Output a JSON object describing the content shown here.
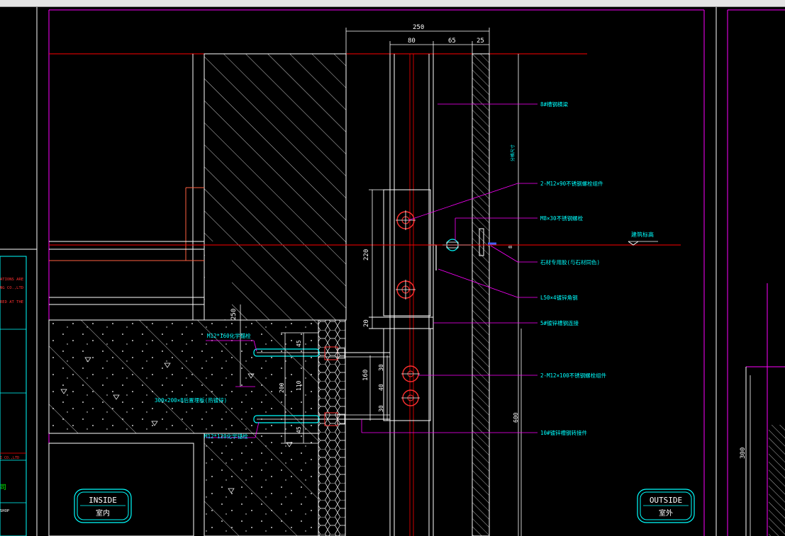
{
  "colors": {
    "background": "#000000",
    "frame": "#ff00ff",
    "dim": "#ffffff",
    "text": "#00ffff",
    "structure": "#ffffff",
    "level_line": "#ff0000",
    "bolt": "#ff3030",
    "hatch": "#ffffff"
  },
  "dimensions": {
    "top_total": "250",
    "top_a": "80",
    "top_b": "65",
    "top_c": "25",
    "v_220": "220",
    "v_20": "20",
    "v_250": "250",
    "v_160": "160",
    "v_30a": "30",
    "v_40": "40",
    "v_30b": "30",
    "v_45a": "45",
    "v_200": "200",
    "v_110": "110",
    "v_45b": "45",
    "v_600": "600",
    "v_8": "8",
    "v_300": "300",
    "v_split": "分格尺寸"
  },
  "labels": {
    "l1": "8#槽钢横梁",
    "l2": "2-M12×90不锈钢螺栓组件",
    "l3": "M8×30不锈钢螺栓",
    "l4": "建筑标高",
    "l5": "石材专用胶(与石材同色)",
    "l6": "L50×4镀锌角钢",
    "l7": "5#镀锌槽钢连接",
    "l8": "2-M12×100不锈钢螺栓组件",
    "l9": "10#镀锌槽钢转接件",
    "l10": "M12*160化学锚栓",
    "l11": "300×200×8后置埋板(热镀锌)",
    "l12": "M12*120化学锚栓"
  },
  "badges": {
    "inside_en": "INSIDE",
    "inside_cn": "室内",
    "outside_en": "OUTSIDE",
    "outside_cn": "室外"
  },
  "sidebar_text": {
    "red1": "ATIONS ARE",
    "red2": "NG CO.,LTD",
    "red3": "RED AT THE",
    "red4": "I CO.,LTD",
    "green1": "司",
    "white1": "SHOP"
  }
}
